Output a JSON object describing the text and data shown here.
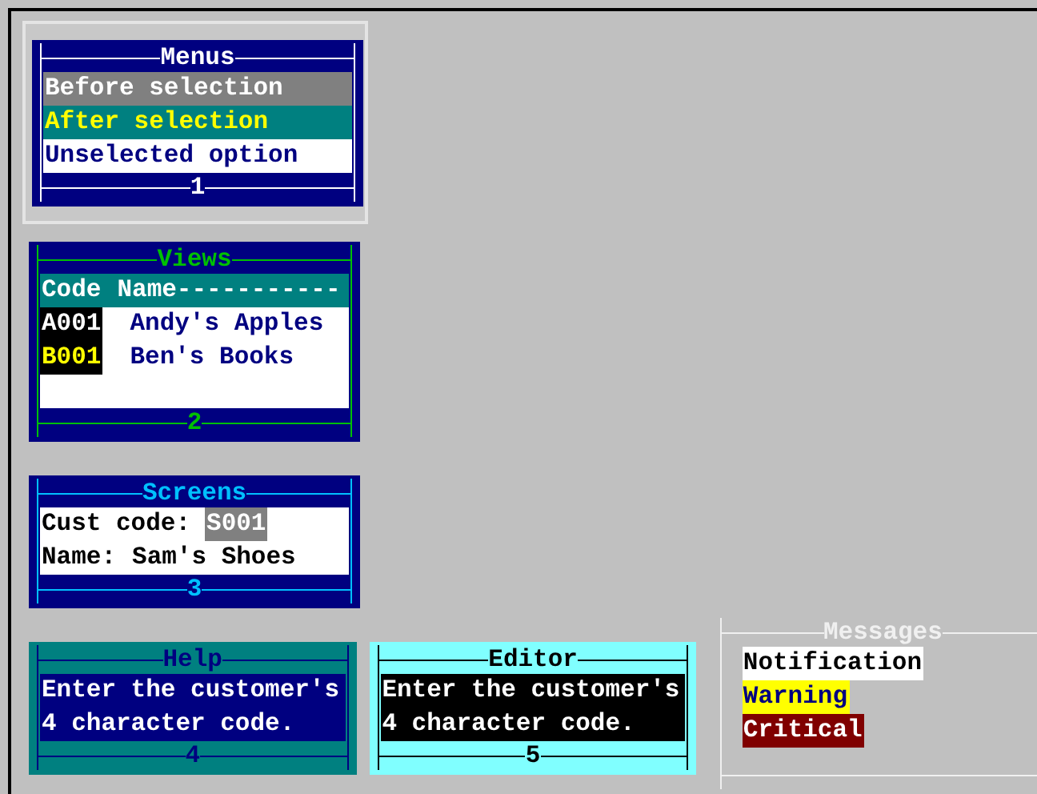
{
  "menus": {
    "title": "Menus",
    "footer": "1",
    "options": [
      {
        "label": "Before selection",
        "kind": "before"
      },
      {
        "label": "After selection",
        "kind": "after"
      },
      {
        "label": "Unselected option",
        "kind": "unselected"
      }
    ]
  },
  "views": {
    "title": "Views",
    "footer": "2",
    "columns": [
      "Code",
      "Name-----------"
    ],
    "rows": [
      {
        "code": "A001",
        "name": "Andy's Apples",
        "selected": false
      },
      {
        "code": "B001",
        "name": "Ben's Books",
        "selected": true
      }
    ]
  },
  "screens": {
    "title": "Screens",
    "footer": "3",
    "fields": [
      {
        "label": "Cust code:",
        "value": "S001",
        "focused": true
      },
      {
        "label": "Name:",
        "value": "Sam's Shoes",
        "focused": false
      }
    ]
  },
  "help": {
    "title": "Help",
    "footer": "4",
    "lines": [
      "Enter the customer's",
      "4 character code."
    ]
  },
  "editor": {
    "title": "Editor",
    "footer": "5",
    "lines": [
      "Enter the customer's",
      "4 character code."
    ]
  },
  "messages": {
    "title": "Messages",
    "items": [
      {
        "label": "Notification",
        "kind": "notification"
      },
      {
        "label": "Warning",
        "kind": "warning"
      },
      {
        "label": "Critical",
        "kind": "critical"
      }
    ]
  }
}
